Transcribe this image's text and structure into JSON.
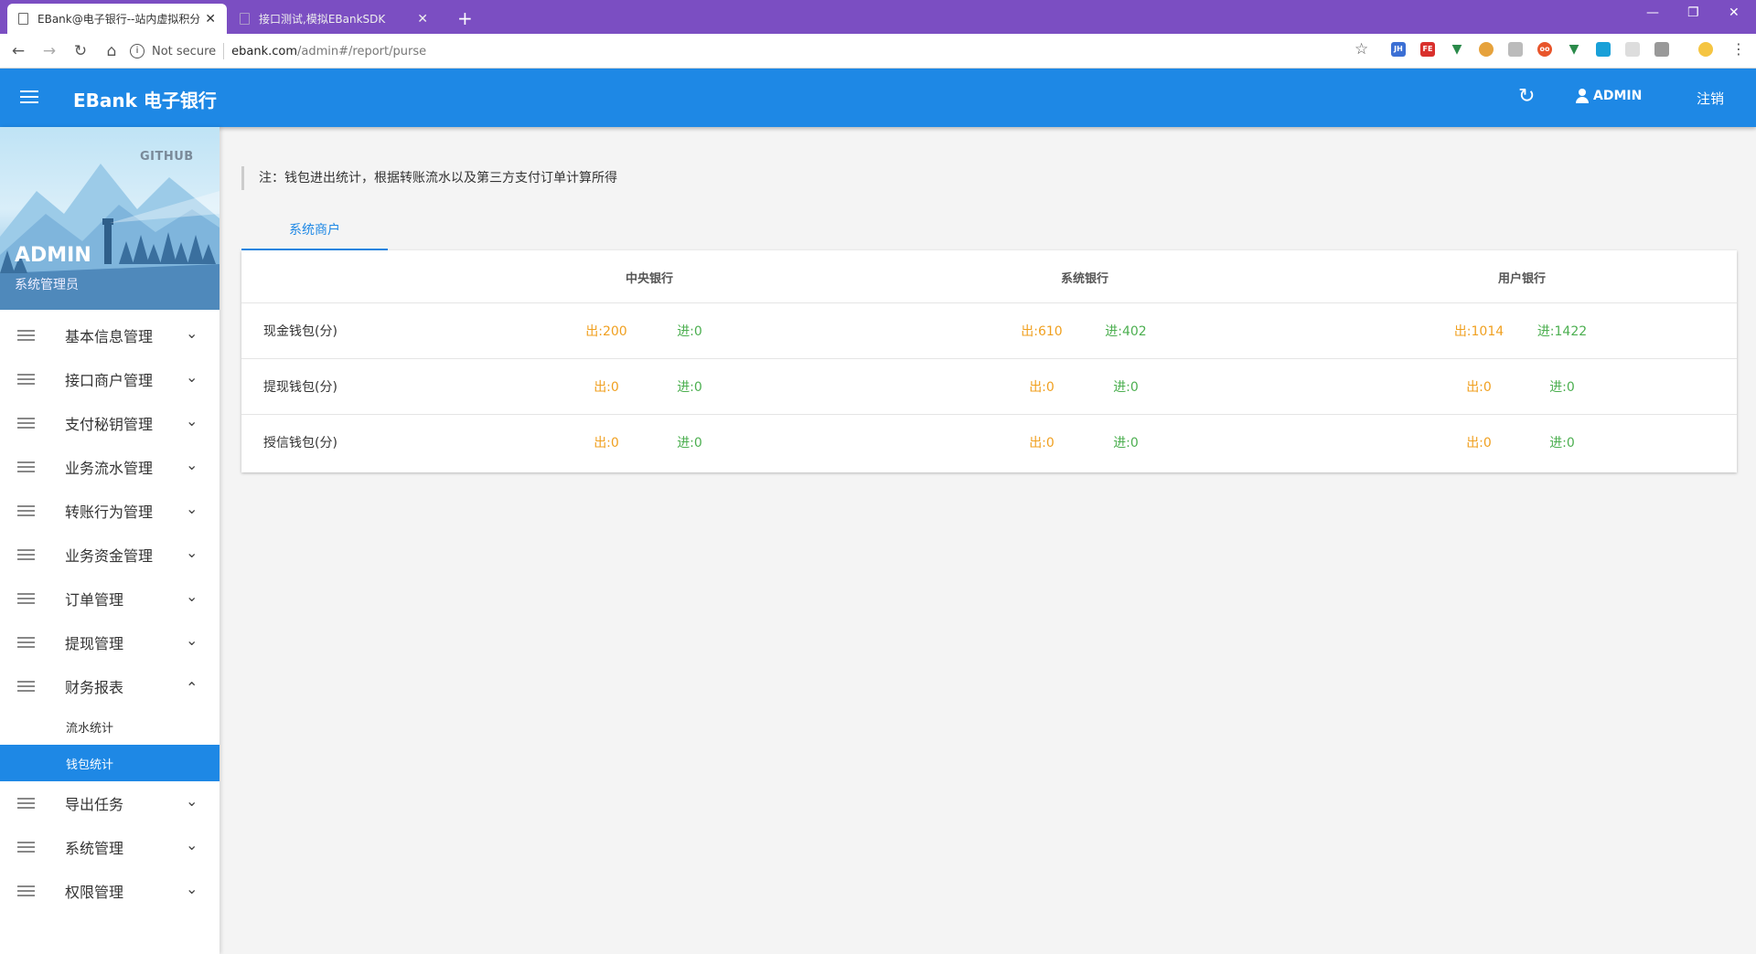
{
  "browser": {
    "tabs": [
      {
        "title": "EBank@电子银行--站内虚拟积分",
        "active": true
      },
      {
        "title": "接口测试,模拟EBankSDK",
        "active": false
      }
    ],
    "new_tab_label": "+",
    "not_secure": "Not secure",
    "url_host": "ebank.com",
    "url_path": "/admin#/report/purse",
    "minimize": "—",
    "maximize": "❐",
    "close": "✕"
  },
  "header": {
    "title": "EBank 电子银行",
    "user": "ADMIN",
    "logout": "注销"
  },
  "profile": {
    "github": "GITHUB",
    "name": "ADMIN",
    "role": "系统管理员"
  },
  "sidebar": {
    "items": [
      {
        "label": "基本信息管理",
        "expanded": false
      },
      {
        "label": "接口商户管理",
        "expanded": false
      },
      {
        "label": "支付秘钥管理",
        "expanded": false
      },
      {
        "label": "业务流水管理",
        "expanded": false
      },
      {
        "label": "转账行为管理",
        "expanded": false
      },
      {
        "label": "业务资金管理",
        "expanded": false
      },
      {
        "label": "订单管理",
        "expanded": false
      },
      {
        "label": "提现管理",
        "expanded": false
      },
      {
        "label": "财务报表",
        "expanded": true
      },
      {
        "label": "导出任务",
        "expanded": false
      },
      {
        "label": "系统管理",
        "expanded": false
      },
      {
        "label": "权限管理",
        "expanded": false
      }
    ],
    "subitems": [
      {
        "label": "流水统计",
        "active": false
      },
      {
        "label": "钱包统计",
        "active": true
      }
    ]
  },
  "main": {
    "note": "注：钱包进出统计，根据转账流水以及第三方支付订单计算所得",
    "tab": "系统商户",
    "columns": [
      "中央银行",
      "系统银行",
      "用户银行"
    ],
    "rows": [
      {
        "name": "现金钱包(分)",
        "values": [
          [
            "出:200",
            "进:0"
          ],
          [
            "出:610",
            "进:402"
          ],
          [
            "出:1014",
            "进:1422"
          ]
        ]
      },
      {
        "name": "提现钱包(分)",
        "values": [
          [
            "出:0",
            "进:0"
          ],
          [
            "出:0",
            "进:0"
          ],
          [
            "出:0",
            "进:0"
          ]
        ]
      },
      {
        "name": "授信钱包(分)",
        "values": [
          [
            "出:0",
            "进:0"
          ],
          [
            "出:0",
            "进:0"
          ],
          [
            "出:0",
            "进:0"
          ]
        ]
      }
    ]
  },
  "colors": {
    "primary": "#1e88e5",
    "out": "#f0a020",
    "in": "#4caf50",
    "browser_frame": "#7b4ec2"
  }
}
